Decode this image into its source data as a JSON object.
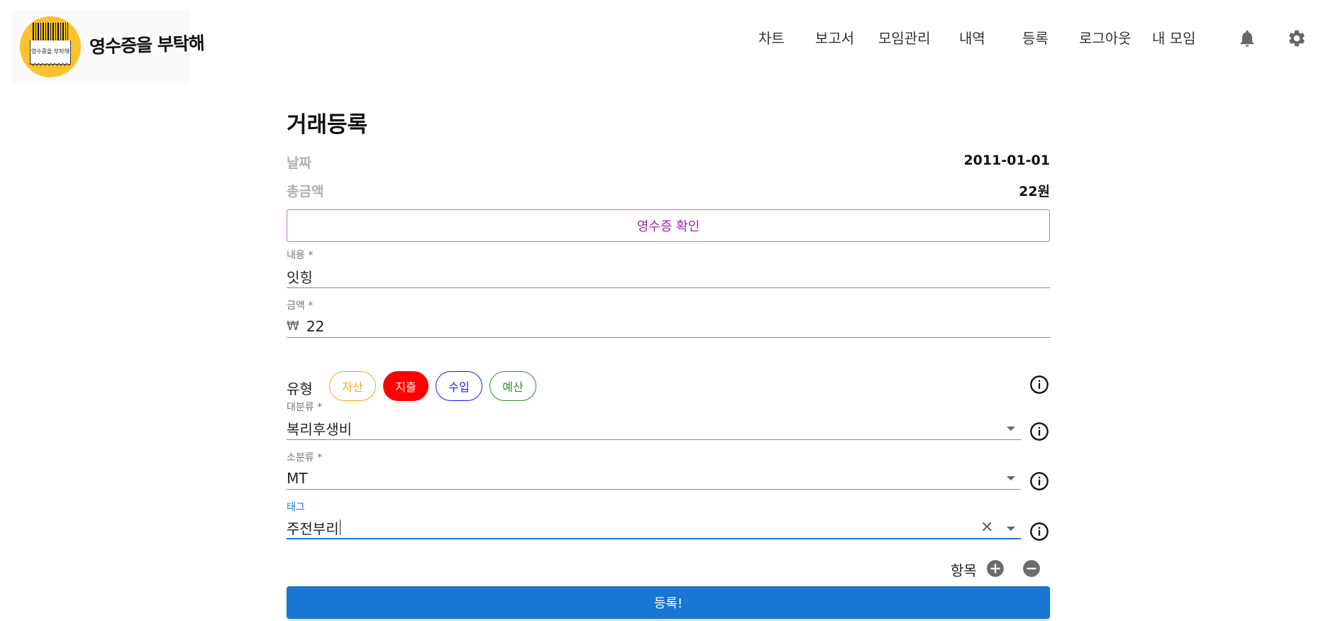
{
  "brand": {
    "name": "영수증을 부탁해",
    "receipt_text": "영수증을 부탁해",
    "accent_color": "#f9c22e"
  },
  "nav": {
    "items": [
      "차트",
      "보고서",
      "모임관리",
      "내역",
      "등록",
      "로그아웃",
      "내 모임"
    ],
    "icons": [
      "bell-icon",
      "gear-icon"
    ]
  },
  "page": {
    "title": "거래등록"
  },
  "summary": {
    "date_label": "날짜",
    "date_value": "2011-01-01",
    "total_label": "총금액",
    "total_value": "22원"
  },
  "receipt_button": "영수증 확인",
  "fields": {
    "content": {
      "label": "내용 *",
      "value": "잇힝"
    },
    "amount": {
      "label": "금액 *",
      "currency": "₩",
      "value": "22"
    },
    "type": {
      "label": "유형",
      "options": [
        {
          "label": "자산",
          "color": "#f5a623",
          "selected": false
        },
        {
          "label": "지출",
          "color": "#ff0000",
          "selected": true
        },
        {
          "label": "수입",
          "color": "#1a1aff",
          "selected": false
        },
        {
          "label": "예산",
          "color": "#2e8b2e",
          "selected": false
        }
      ]
    },
    "major_category": {
      "label": "대분류 *",
      "value": "복리후생비"
    },
    "minor_category": {
      "label": "소분류 *",
      "value": "MT"
    },
    "tag": {
      "label": "태그",
      "value": "주전부리"
    }
  },
  "items": {
    "label": "항목"
  },
  "submit_button": "등록!",
  "colors": {
    "primary": "#1976d2",
    "secondary": "#9c27b0",
    "muted_label": "#b0b0b0"
  }
}
